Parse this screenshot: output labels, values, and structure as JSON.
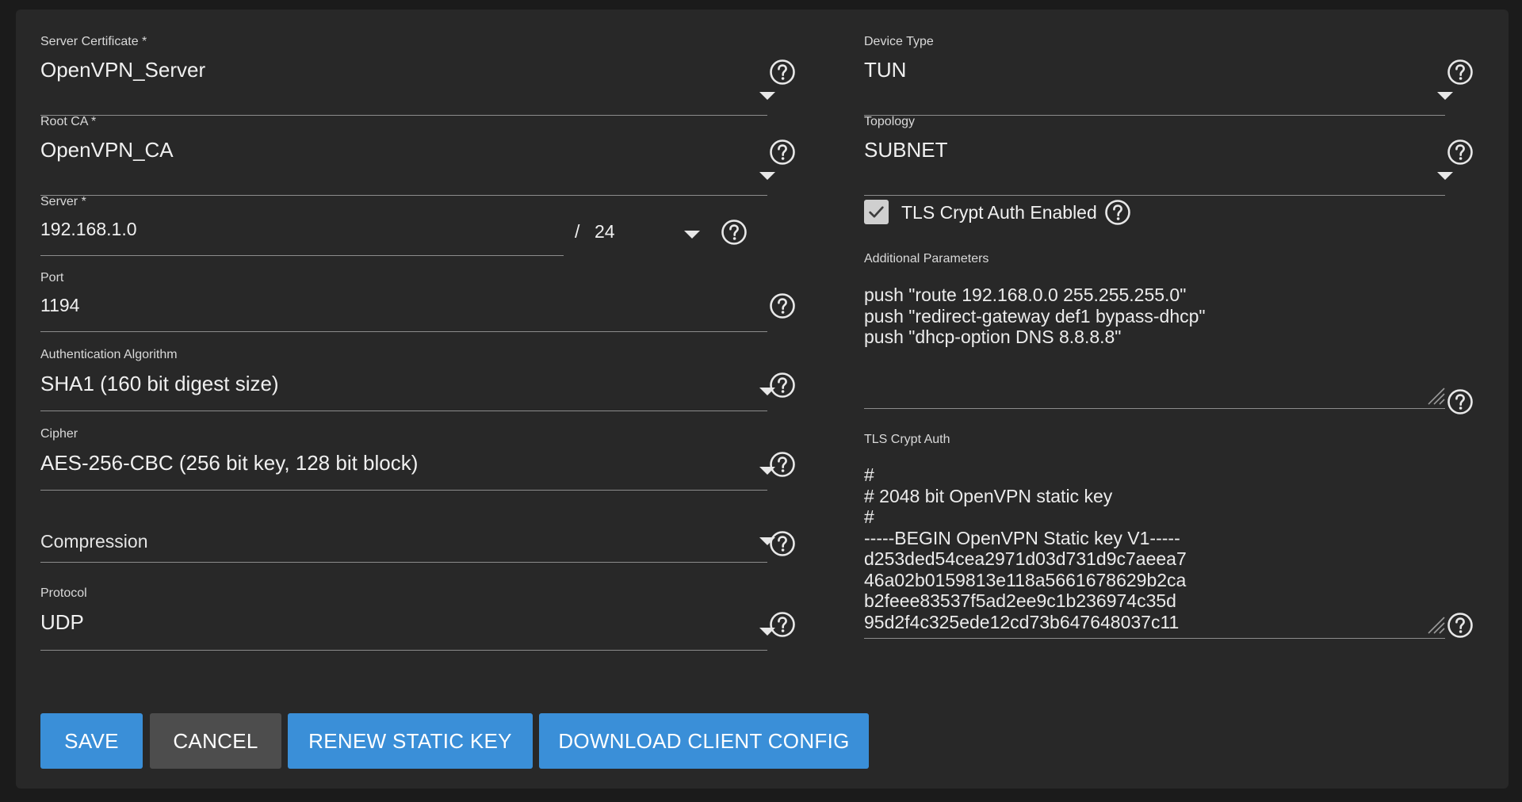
{
  "left_column": {
    "server_certificate": {
      "label": "Server Certificate *",
      "value": "OpenVPN_Server"
    },
    "root_ca": {
      "label": "Root CA *",
      "value": "OpenVPN_CA"
    },
    "server": {
      "label": "Server *",
      "value": "192.168.1.0",
      "separator": "/",
      "netmask": "24"
    },
    "port": {
      "label": "Port",
      "value": "1194"
    },
    "authentication_algorithm": {
      "label": "Authentication Algorithm",
      "value": "SHA1 (160 bit digest size)"
    },
    "cipher": {
      "label": "Cipher",
      "value": "AES-256-CBC (256 bit key, 128 bit block)"
    },
    "compression": {
      "placeholder": "Compression",
      "value": ""
    },
    "protocol": {
      "label": "Protocol",
      "value": "UDP"
    }
  },
  "right_column": {
    "device_type": {
      "label": "Device Type",
      "value": "TUN"
    },
    "topology": {
      "label": "Topology",
      "value": "SUBNET"
    },
    "tls_crypt_auth_enabled": {
      "label": "TLS Crypt Auth Enabled",
      "checked": true
    },
    "additional_parameters": {
      "label": "Additional Parameters",
      "value": "push \"route 192.168.0.0 255.255.255.0\"\npush \"redirect-gateway def1 bypass-dhcp\"\npush \"dhcp-option DNS 8.8.8.8\""
    },
    "tls_crypt_auth": {
      "label": "TLS Crypt Auth",
      "value": "#\n# 2048 bit OpenVPN static key\n#\n-----BEGIN OpenVPN Static key V1-----\nd253ded54cea2971d03d731d9c7aeea7\n46a02b0159813e118a5661678629b2ca\nb2feee83537f5ad2ee9c1b236974c35d\n95d2f4c325ede12cd73b647648037c11"
    }
  },
  "buttons": {
    "save": "SAVE",
    "cancel": "CANCEL",
    "renew_static_key": "RENEW STATIC KEY",
    "download_client_config": "DOWNLOAD CLIENT CONFIG"
  },
  "colors": {
    "background": "#1b1b1b",
    "card": "#282828",
    "primary_button": "#3a8fd8",
    "secondary_button": "#4d4d4d",
    "checkbox": "#cfcfcf"
  },
  "icons": {
    "help": "help-circle-icon",
    "dropdown": "caret-down-icon",
    "checkbox": "check-icon",
    "resize": "resize-grip-icon"
  }
}
